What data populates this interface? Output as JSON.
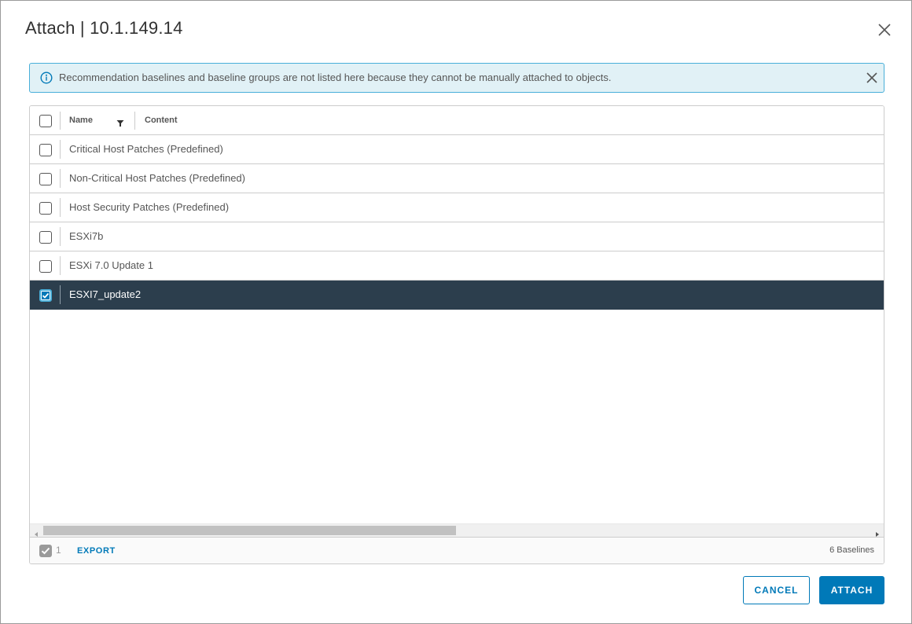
{
  "dialog": {
    "title": "Attach | 10.1.149.14"
  },
  "alert": {
    "message": "Recommendation baselines and baseline groups are not listed here because they cannot be manually attached to objects."
  },
  "grid": {
    "columns": [
      "Name",
      "Content"
    ],
    "rows": [
      {
        "name": "Critical Host Patches (Predefined)",
        "checked": false
      },
      {
        "name": "Non-Critical Host Patches (Predefined)",
        "checked": false
      },
      {
        "name": "Host Security Patches (Predefined)",
        "checked": false
      },
      {
        "name": "ESXi7b",
        "checked": false
      },
      {
        "name": "ESXi 7.0 Update 1",
        "checked": false
      },
      {
        "name": "ESXI7_update2",
        "checked": true
      }
    ],
    "footer": {
      "selected_count": "1",
      "export_label": "EXPORT",
      "total_label": "6 Baselines"
    }
  },
  "buttons": {
    "cancel": "CANCEL",
    "attach": "ATTACH"
  },
  "colors": {
    "accent": "#0079b8",
    "selected_row": "#2c3e4d",
    "alert_bg": "#e1f1f6",
    "alert_border": "#49afd9"
  },
  "icons": {
    "close": "close-icon",
    "info": "info-icon",
    "filter": "filter-icon",
    "check": "check-icon"
  }
}
